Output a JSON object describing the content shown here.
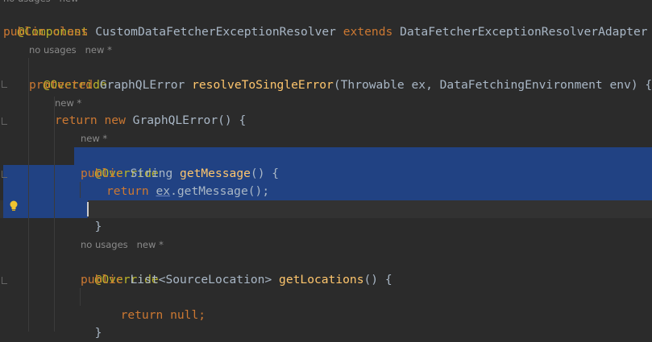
{
  "editor": {
    "top_hint": "no usages   new *",
    "hint1": "no usages   new *",
    "hint2": "new *",
    "hint3": "new *",
    "hint4": "no usages   new *",
    "l1_ann": "@Component",
    "l2_kw": "public class",
    "l2_name": "CustomDataFetcherExceptionResolver",
    "l2_kw2": "extends",
    "l2_rest": "DataFetcherExceptionResolverAdapter {",
    "l3_ann": "@Override",
    "l4_kw": "protected",
    "l4_type": "GraphQLError",
    "l4_fn": "resolveToSingleError",
    "l4_rest": "(Throwable ex, DataFetchingEnvironment env) {",
    "l5_kw": "return new",
    "l5_rest": "GraphQLError() {",
    "l6_ann": "@Override",
    "l7_kw": "public",
    "l7_type": "String",
    "l7_fn": "getMessage",
    "l7_rest": "() {",
    "l8_kw": "return",
    "l8_field": "ex",
    "l8_rest": ".getMessage();",
    "l9": "}",
    "l10_ann": "@Override",
    "l11_kw": "public",
    "l11_type": "List<SourceLocation>",
    "l11_fn": "getLocations",
    "l11_rest": "() {",
    "l12_kw": "return null;",
    "l13": "}"
  },
  "colors": {
    "background": "#2b2b2b",
    "selection": "#214283",
    "annotation": "#bbb529",
    "keyword": "#cc7832",
    "method": "#ffc66d",
    "text": "#a9b7c6"
  }
}
